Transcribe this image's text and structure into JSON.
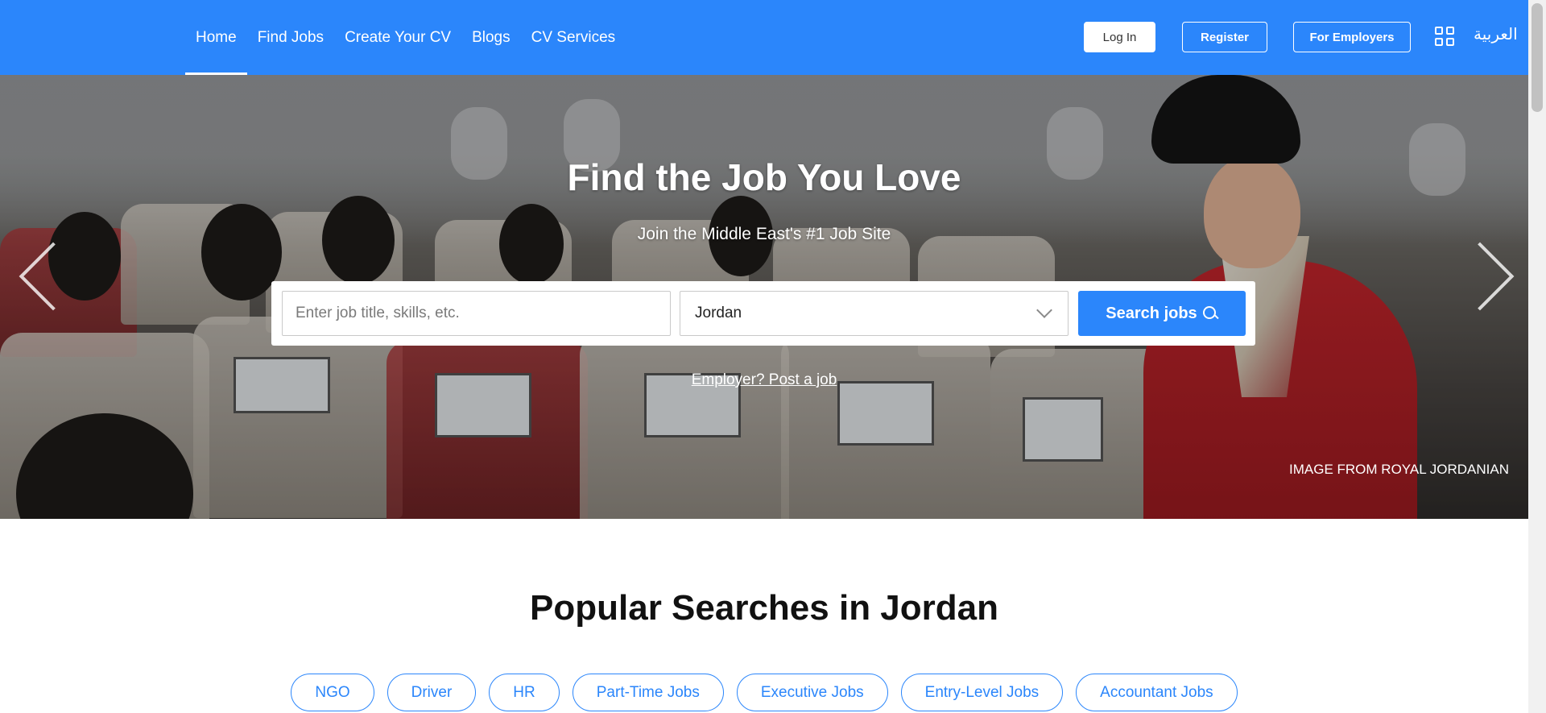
{
  "header": {
    "nav": [
      {
        "label": "Home",
        "active": true
      },
      {
        "label": "Find Jobs"
      },
      {
        "label": "Create Your CV"
      },
      {
        "label": "Blogs"
      },
      {
        "label": "CV Services"
      }
    ],
    "login_label": "Log In",
    "register_label": "Register",
    "employers_label": "For Employers",
    "apps_icon": "grid-icon",
    "language_label": "العربية",
    "brand_color": "#2b86fb"
  },
  "hero": {
    "title": "Find the Job You Love",
    "subtitle": "Join the Middle East's #1 Job Site",
    "search": {
      "placeholder": "Enter job title, skills, etc.",
      "value": "",
      "country": "Jordan",
      "button_label": "Search jobs"
    },
    "post_job_label": "Employer? Post a job",
    "image_credit": "IMAGE FROM ROYAL JORDANIAN"
  },
  "popular": {
    "title": "Popular Searches in Jordan",
    "tags": [
      "NGO",
      "Driver",
      "HR",
      "Part-Time Jobs",
      "Executive Jobs",
      "Entry-Level Jobs",
      "Accountant Jobs"
    ]
  }
}
